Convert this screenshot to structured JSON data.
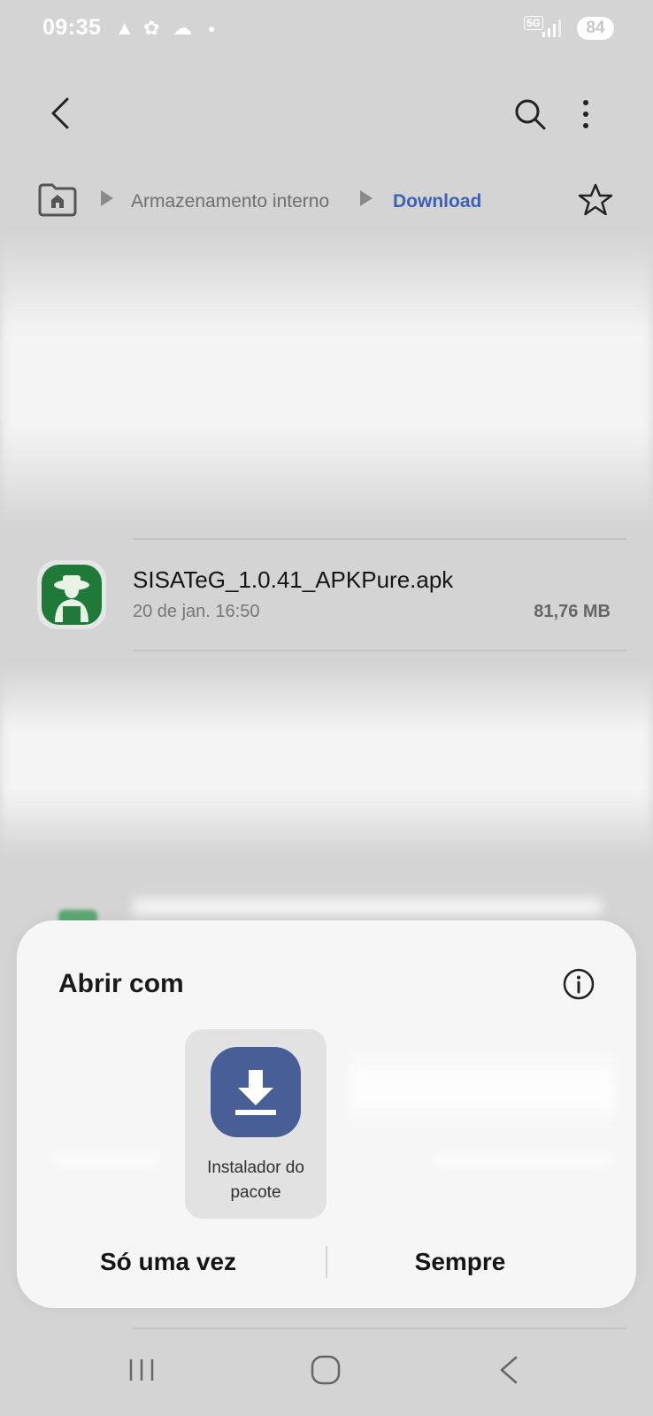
{
  "status_bar": {
    "time": "09:35",
    "network": "5G",
    "battery": "84"
  },
  "breadcrumb": {
    "items": [
      "Armazenamento interno",
      "Download"
    ]
  },
  "file": {
    "name": "SISATeG_1.0.41_APKPure.apk",
    "date": "20 de jan. 16:50",
    "size": "81,76 MB",
    "icon": "farmer-app-icon",
    "icon_color": "#1f7a3a"
  },
  "open_with_sheet": {
    "title": "Abrir com",
    "apps": [
      {
        "label_line1": "Instalador do",
        "label_line2": "pacote",
        "icon": "download-icon",
        "color": "#485e96"
      }
    ],
    "actions": {
      "once": "Só uma vez",
      "always": "Sempre"
    }
  },
  "colors": {
    "accent": "#3d62b5",
    "background": "#d4d4d4",
    "sheet": "#f6f6f6"
  }
}
